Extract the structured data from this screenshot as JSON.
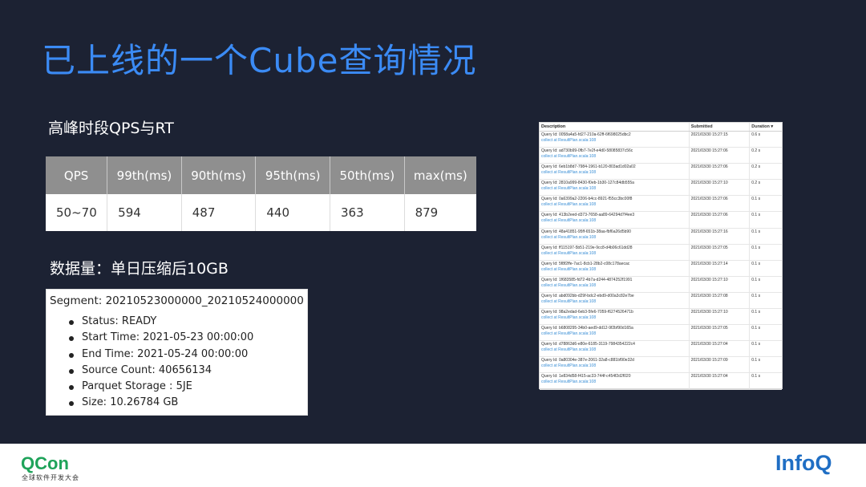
{
  "title": "已上线的一个Cube查询情况",
  "qps_heading": "高峰时段QPS与RT",
  "qps_table": {
    "headers": [
      "QPS",
      "99th(ms)",
      "90th(ms)",
      "95th(ms)",
      "50th(ms)",
      "max(ms)"
    ],
    "row": [
      "50~70",
      "594",
      "487",
      "440",
      "363",
      "879"
    ]
  },
  "data_heading": "数据量：单日压缩后10GB",
  "segment": {
    "title": "Segment: 20210523000000_20210524000000",
    "items": [
      "Status: READY",
      "Start Time: 2021-05-23 00:00:00",
      "End Time: 2021-05-24 00:00:00",
      "Source Count: 40656134",
      "Parquet Storage : 5JE",
      "Size: 10.26784 GB"
    ]
  },
  "query_panel": {
    "headers": [
      "Description",
      "Submitted",
      "Duration ▾"
    ],
    "link_text": "collect at ResultPlan.scala:108",
    "rows": [
      {
        "id": "Query Id: 0058a4a5-fd27-210a-62ff-6f698025dbc2",
        "submitted": "2021/03/30 15:27:15",
        "duration": "0.6 s"
      },
      {
        "id": "Query Id: ad730b99-0fb7-7e2f-e4d0-58085837c56c",
        "submitted": "2021/03/30 15:27:06",
        "duration": "0.2 s"
      },
      {
        "id": "Query Id: 6eb1b8d7-7984-1961-b120-803ad1d02a02",
        "submitted": "2021/03/30 15:27:06",
        "duration": "0.2 s"
      },
      {
        "id": "Query Id: 2810a999-8430-f0eb-1b30-127c84db555a",
        "submitted": "2021/03/30 15:27:10",
        "duration": "0.2 s"
      },
      {
        "id": "Query Id: 0a6399a2-2206-b4cc-8921-f55cc3bc00f8",
        "submitted": "2021/03/30 15:27:06",
        "duration": "0.1 s"
      },
      {
        "id": "Query Id: 413b2eed-d373-7658-aa89-64294d7f4ee3",
        "submitted": "2021/03/30 15:27:06",
        "duration": "0.1 s"
      },
      {
        "id": "Query Id: 48a41851-95ff-651b-38aa-fbf6a26d5b90",
        "submitted": "2021/03/30 15:27:16",
        "duration": "0.1 s"
      },
      {
        "id": "Query Id: ff115197-5b51-219e-9cc8-d4b06c61dd28",
        "submitted": "2021/03/30 15:27:05",
        "duration": "0.1 s"
      },
      {
        "id": "Query Id: 5f8f2ffe-7ac1-8cb1-28b2-c08c178aecac",
        "submitted": "2021/03/30 15:27:14",
        "duration": "0.1 s"
      },
      {
        "id": "Query Id: 1f683585-fd72-4b7a-d244-4874252f1991",
        "submitted": "2021/03/30 15:27:10",
        "duration": "0.1 s"
      },
      {
        "id": "Query Id: abd092bb-d29f-bdc2-ebd9-d00a3c82e7be",
        "submitted": "2021/03/30 15:27:08",
        "duration": "0.1 s"
      },
      {
        "id": "Query Id: 98a2edad-6eb3-5fe6-7059-f6274526471b",
        "submitted": "2021/03/30 15:27:10",
        "duration": "0.1 s"
      },
      {
        "id": "Query Id: b6808295-34b0-aed9-dd12-9f2bf90d165a",
        "submitted": "2021/03/30 15:27:05",
        "duration": "0.1 s"
      },
      {
        "id": "Query Id: d78863d6-e80e-6185-3119-7984354222c4",
        "submitted": "2021/03/30 15:27:04",
        "duration": "0.1 s"
      },
      {
        "id": "Query Id: 0a80304e-387e-2061-32a8-c881bf90e32d",
        "submitted": "2021/03/30 15:27:09",
        "duration": "0.1 s"
      },
      {
        "id": "Query Id: 1e834d58-f415-ac33-744f-c454f2d2f020",
        "submitted": "2021/03/30 15:27:04",
        "duration": "0.1 s"
      }
    ]
  },
  "footer": {
    "qcon_logo": "QCon",
    "qcon_sub": "全球软件开发大会",
    "infoq_logo": "InfoQ"
  },
  "colors": {
    "background": "#1c2233",
    "title": "#3b8bf5",
    "table_header": "#8f8f8f",
    "qcon": "#1fa35a",
    "infoq": "#1f6ec4"
  }
}
